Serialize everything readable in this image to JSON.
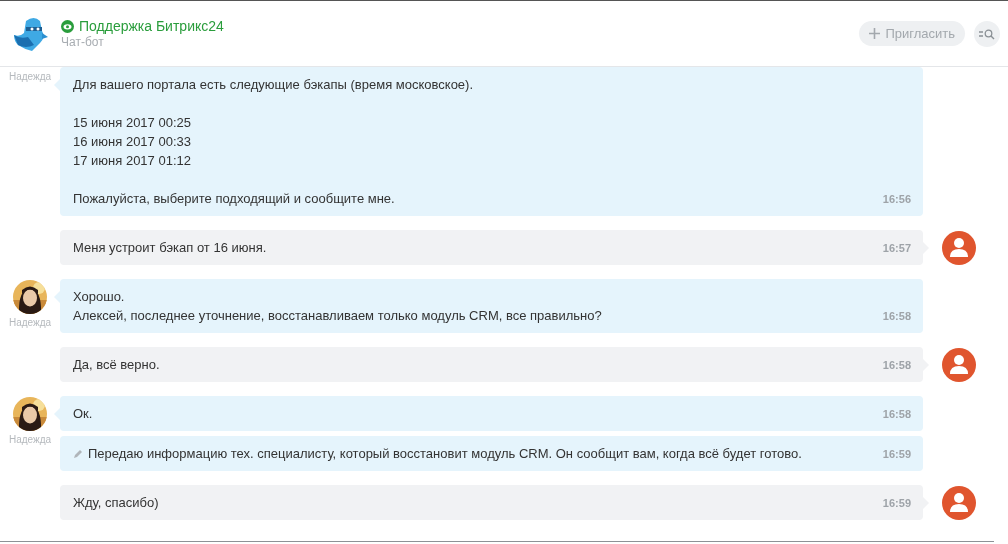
{
  "header": {
    "title": "Поддержка Битрикс24",
    "subtitle": "Чат-бот",
    "invite_button": "Пригласить"
  },
  "groups": [
    {
      "kind": "bot",
      "author": "Надежда",
      "avatar": false,
      "messages": [
        {
          "text": "Для вашего портала есть следующие бэкапы (время московское).\n\n15 июня 2017 00:25\n16 июня 2017 00:33\n17 июня 2017 01:12\n\nПожалуйста, выберите подходящий и сообщите мне.",
          "time": "16:56",
          "edited": false
        }
      ]
    },
    {
      "kind": "user",
      "messages": [
        {
          "text": "Меня устроит бэкап от 16 июня.",
          "time": "16:57",
          "edited": false
        }
      ]
    },
    {
      "kind": "bot",
      "author": "Надежда",
      "avatar": true,
      "messages": [
        {
          "text": "Хорошо.\nАлексей, последнее уточнение, восстанавливаем только модуль CRM, все правильно?",
          "time": "16:58",
          "edited": false
        }
      ]
    },
    {
      "kind": "user",
      "messages": [
        {
          "text": "Да, всё верно.",
          "time": "16:58",
          "edited": false
        }
      ]
    },
    {
      "kind": "bot",
      "author": "Надежда",
      "avatar": true,
      "messages": [
        {
          "text": "Ок.",
          "time": "16:58",
          "edited": false
        },
        {
          "text": "Передаю информацию тех. специалисту, который восстановит модуль CRM. Он сообщит вам, когда всё будет готово.",
          "time": "16:59",
          "edited": true
        }
      ]
    },
    {
      "kind": "user",
      "messages": [
        {
          "text": "Жду, спасибо)",
          "time": "16:59",
          "edited": false
        }
      ]
    }
  ]
}
